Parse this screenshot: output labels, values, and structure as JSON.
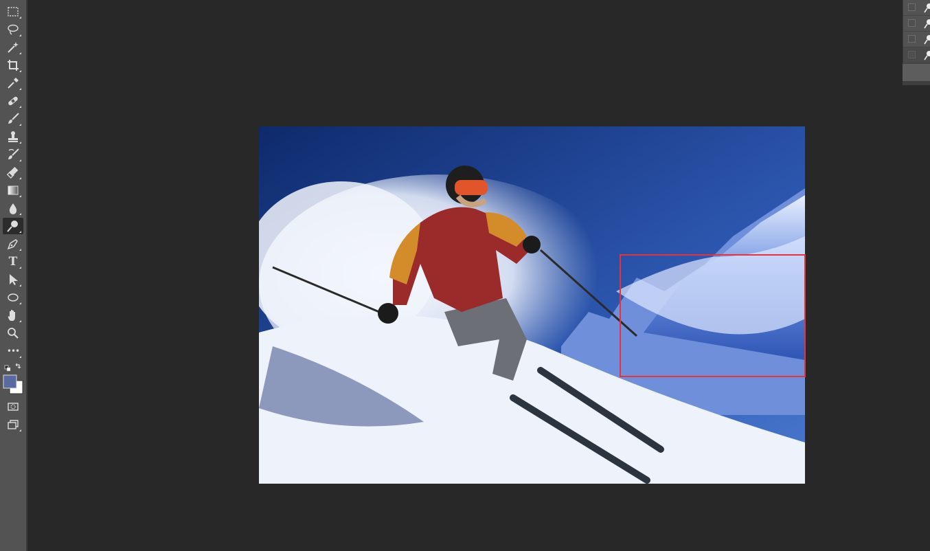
{
  "app": {
    "accent": "#e6333a",
    "canvas_bg": "#282828",
    "toolbar_bg": "#535353"
  },
  "toolbar": {
    "tools": [
      {
        "name": "rectangular-marquee-icon"
      },
      {
        "name": "lasso-icon"
      },
      {
        "name": "magic-wand-icon"
      },
      {
        "name": "crop-icon"
      },
      {
        "name": "eyedropper-icon"
      },
      {
        "name": "healing-brush-icon"
      },
      {
        "name": "brush-icon"
      },
      {
        "name": "clone-stamp-icon"
      },
      {
        "name": "history-brush-icon"
      },
      {
        "name": "eraser-icon"
      },
      {
        "name": "gradient-icon"
      },
      {
        "name": "blur-icon"
      },
      {
        "name": "dodge-icon",
        "active": true
      },
      {
        "name": "pen-icon"
      },
      {
        "name": "type-icon",
        "label": "T"
      },
      {
        "name": "path-selection-icon"
      },
      {
        "name": "ellipse-icon"
      },
      {
        "name": "hand-icon"
      },
      {
        "name": "zoom-icon"
      },
      {
        "name": "more-tools-icon",
        "label": "•••"
      }
    ],
    "foreground_color": "#5a6aa0",
    "background_color": "#ffffff"
  },
  "document": {
    "selection_color": "#e6333a"
  },
  "layers_panel": {
    "rows": 4
  }
}
